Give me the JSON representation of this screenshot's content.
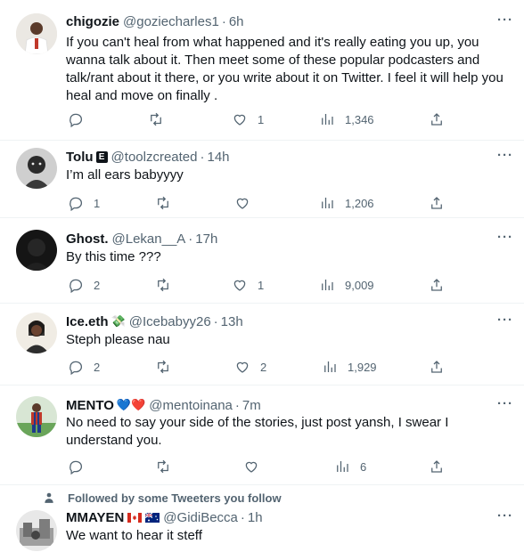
{
  "tweets": [
    {
      "name": "chigozie",
      "handle": "@goziecharles1",
      "time": "6h",
      "text": "If you can't heal from what happened and it's really eating you up, you wanna talk about it. Then meet some of these popular podcasters and talk/rant  about it there, or you write about it on Twitter. I feel it will help you heal and move on finally .",
      "replies": "",
      "retweets": "",
      "likes": "1",
      "views": "1,346"
    },
    {
      "name": "Tolu",
      "badge": "E",
      "handle": "@toolzcreated",
      "time": "14h",
      "text": "I’m all ears babyyyy",
      "replies": "1",
      "retweets": "",
      "likes": "",
      "views": "1,206"
    },
    {
      "name": "Ghost.",
      "handle": "@Lekan__A",
      "time": "17h",
      "text": "By this time ???",
      "replies": "2",
      "retweets": "",
      "likes": "1",
      "views": "9,009"
    },
    {
      "name": "Ice.eth",
      "badge": "💸",
      "handle": "@Icebabyy26",
      "time": "13h",
      "text": "Steph please nau",
      "replies": "2",
      "retweets": "",
      "likes": "2",
      "views": "1,929"
    },
    {
      "name": "MENTO",
      "badge": "💙❤️",
      "handle": "@mentoinana",
      "time": "7m",
      "text": "No need to say your side of the stories, just post yansh, I swear I understand you.",
      "replies": "",
      "retweets": "",
      "likes": "",
      "views": "6"
    },
    {
      "social_context": "Followed by some Tweeters you follow",
      "name": "MMAYEN",
      "handle": "@GidiBecca",
      "time": "1h",
      "text": "We want to hear it steff"
    }
  ],
  "icons": {
    "reply": "reply-icon",
    "retweet": "retweet-icon",
    "like": "like-icon",
    "views": "views-icon",
    "share": "share-icon",
    "more": "more-icon",
    "person": "person-icon"
  },
  "colors": {
    "text": "#0f1419",
    "secondary": "#536471",
    "divider": "#eff3f4"
  }
}
